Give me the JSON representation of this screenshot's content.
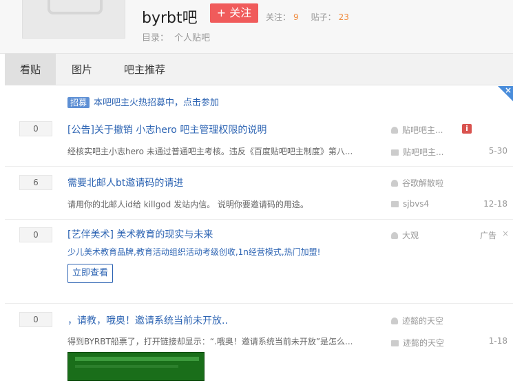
{
  "header": {
    "forum_name": "byrbt吧",
    "follow_label": "+ 关注",
    "follow_count_label": "关注：",
    "follow_count": "9",
    "post_count_label": "贴子：",
    "post_count": "23",
    "catalog_label": "目录：",
    "catalog_value": "个人贴吧"
  },
  "tabs": [
    {
      "label": "看贴"
    },
    {
      "label": "图片"
    },
    {
      "label": "吧主推荐"
    }
  ],
  "notice": {
    "tag": "招募",
    "text": "本吧吧主火热招募中，点击参加"
  },
  "threads": [
    {
      "replies": "0",
      "title": "[公告]关于撤销 小志hero 吧主管理权限的说明",
      "excerpt": "经核实吧主小志hero 未通过普通吧主考核。违反《百度贴吧吧主制度》第八...",
      "author": "贴吧吧主...",
      "last_reply": "贴吧吧主...",
      "date": "5-30"
    },
    {
      "replies": "6",
      "title": "需要北邮人bt邀请码的请进",
      "excerpt": "请用你的北邮人id给 killgod 发站内信。 说明你要邀请码的用途。",
      "author": "谷歌解散啦",
      "last_reply": "sjbvs4",
      "date": "12-18"
    },
    {
      "replies": "0",
      "title": "[艺伴美术] 美术教育的现实与未来",
      "excerpt": "少儿美术教育品牌,教育活动组织活动考级创收,1n经营模式,热门加盟!",
      "author": "大观",
      "ad_label": "广告",
      "ad_close": "×",
      "ad_button": "立即查看"
    },
    {
      "replies": "0",
      "title": "，请教，哦奥！邀请系统当前未开放..",
      "excerpt": "得到BYRBT船票了，打开链接却显示：“.哦奥！邀请系统当前未开放”是怎么...",
      "author": "迹懿的天空",
      "last_reply": "迹懿的天空",
      "date": "1-18"
    }
  ],
  "info_icon": "i",
  "corner_close": "×"
}
